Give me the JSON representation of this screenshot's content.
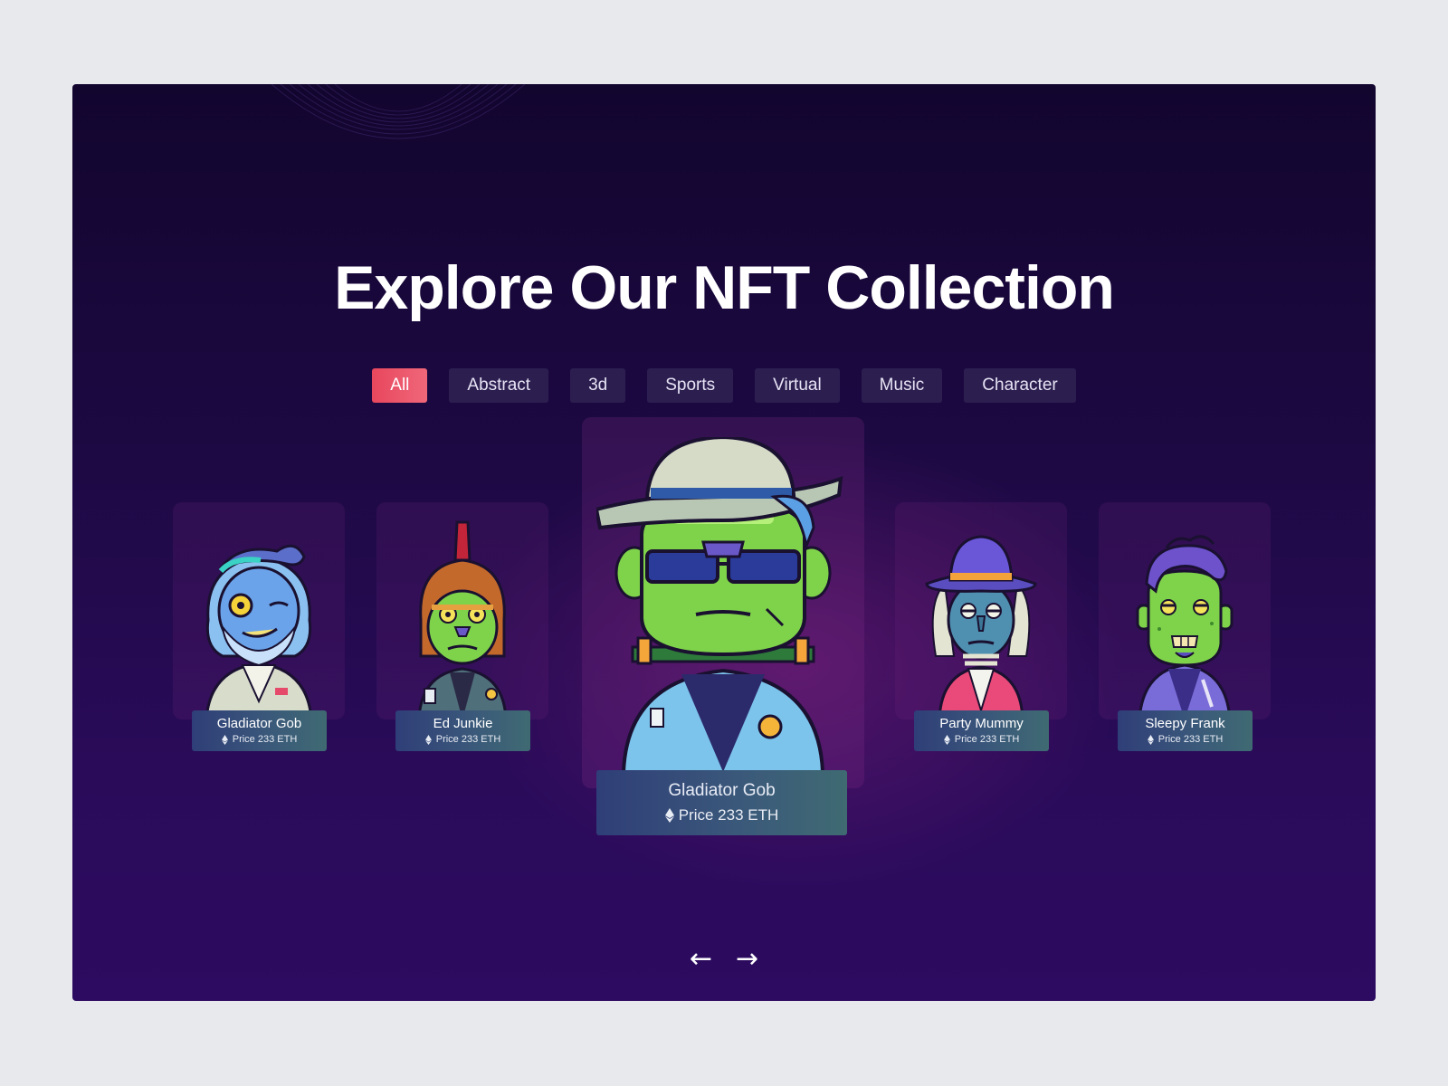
{
  "hero": {
    "title": "Explore Our NFT Collection"
  },
  "filters": [
    {
      "label": "All",
      "active": true
    },
    {
      "label": "Abstract"
    },
    {
      "label": "3d"
    },
    {
      "label": "Sports"
    },
    {
      "label": "Virtual"
    },
    {
      "label": "Music"
    },
    {
      "label": "Character"
    }
  ],
  "cards": [
    {
      "name": "Gladiator Gob",
      "price": "Price 233 ETH",
      "icon": "ethereum-icon"
    },
    {
      "name": "Ed Junkie",
      "price": "Price 233 ETH",
      "icon": "ethereum-icon"
    },
    {
      "name": "Gladiator Gob",
      "price": "Price 233 ETH",
      "icon": "ethereum-icon",
      "featured": true
    },
    {
      "name": "Party Mummy",
      "price": "Price 233 ETH",
      "icon": "ethereum-icon"
    },
    {
      "name": "Sleepy Frank",
      "price": "Price 233 ETH",
      "icon": "ethereum-icon"
    }
  ],
  "nav": {
    "prev": "←",
    "next": "→"
  },
  "colors": {
    "accent": "#e8475d",
    "chip": "#2c1f50",
    "background_top": "#12052e",
    "background_bottom": "#2d0b60"
  }
}
